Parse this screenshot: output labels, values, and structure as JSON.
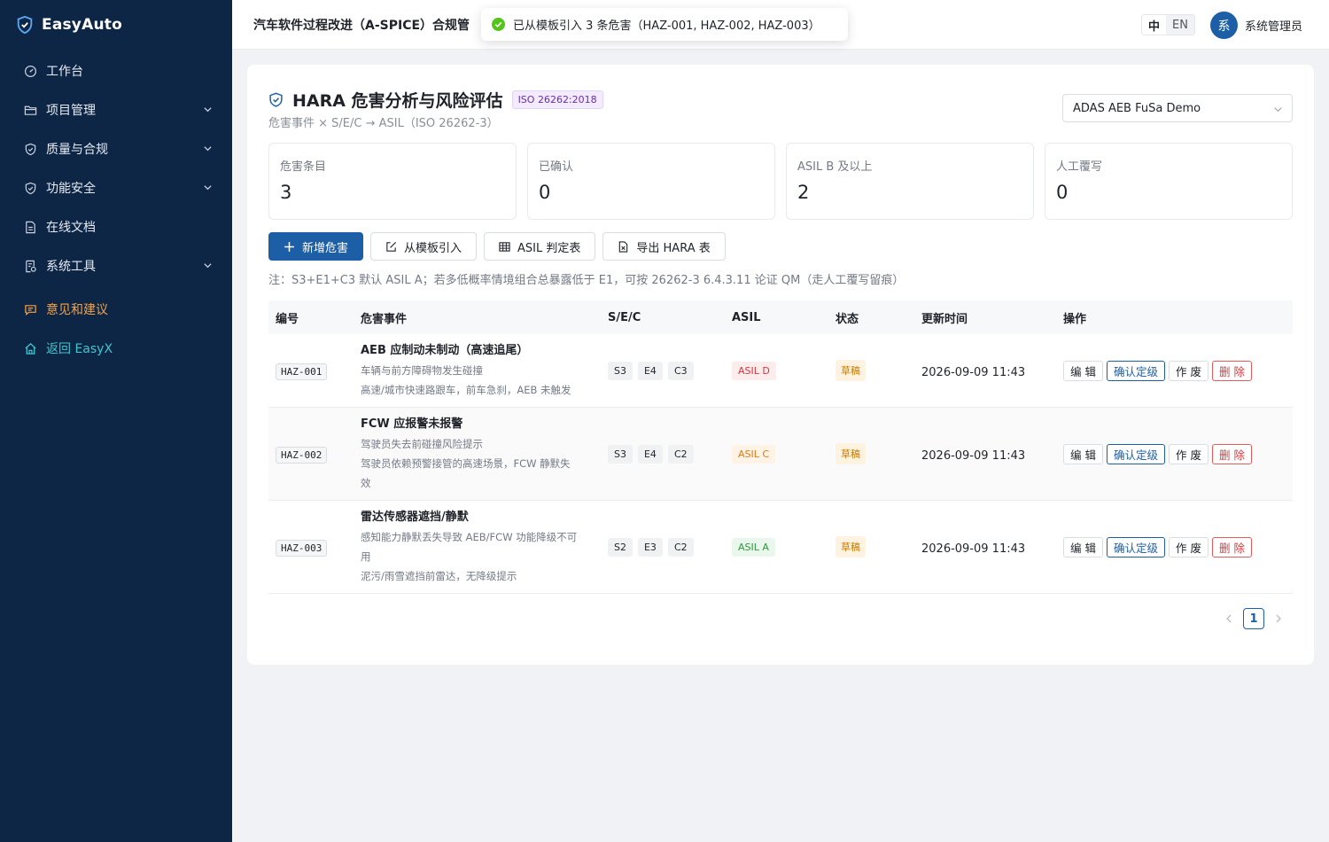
{
  "brand": {
    "name": "EasyAuto"
  },
  "sidebar": {
    "items": [
      {
        "label": "工作台",
        "icon": "dashboard-icon",
        "expandable": false
      },
      {
        "label": "项目管理",
        "icon": "folder-icon",
        "expandable": true
      },
      {
        "label": "质量与合规",
        "icon": "shield-icon",
        "expandable": true
      },
      {
        "label": "功能安全",
        "icon": "shield-check-icon",
        "expandable": true
      },
      {
        "label": "在线文档",
        "icon": "document-icon",
        "expandable": false
      },
      {
        "label": "系统工具",
        "icon": "tools-icon",
        "expandable": true
      }
    ],
    "feedback_label": "意见和建议",
    "back_label": "返回 EasyX"
  },
  "header": {
    "app_title": "汽车软件过程改进（A-SPICE）合规管",
    "lang_zh": "中",
    "lang_en": "EN",
    "avatar_initial": "系",
    "username": "系统管理员"
  },
  "toast": {
    "text": "已从模板引入 3 条危害（HAZ-001, HAZ-002, HAZ-003）"
  },
  "page": {
    "title": "HARA 危害分析与风险评估",
    "standard_tag": "ISO 26262:2018",
    "subtitle": "危害事件 × S/E/C → ASIL（ISO 26262-3）",
    "project_selected": "ADAS AEB FuSa Demo"
  },
  "stats": [
    {
      "label": "危害条目",
      "value": "3"
    },
    {
      "label": "已确认",
      "value": "0"
    },
    {
      "label": "ASIL B 及以上",
      "value": "2"
    },
    {
      "label": "人工覆写",
      "value": "0"
    }
  ],
  "toolbar": {
    "add_label": "新增危害",
    "import_label": "从模板引入",
    "asil_table_label": "ASIL 判定表",
    "export_label": "导出 HARA 表"
  },
  "note": "注：S3+E1+C3 默认 ASIL A；若多低概率情境组合总暴露低于 E1，可按 26262-3 6.4.3.11 论证 QM（走人工覆写留痕）",
  "table": {
    "headers": {
      "id": "编号",
      "event": "危害事件",
      "sec": "S/E/C",
      "asil": "ASIL",
      "status": "状态",
      "time": "更新时间",
      "ops": "操作"
    },
    "ops_labels": {
      "edit": "编 辑",
      "confirm": "确认定级",
      "void": "作 废",
      "delete": "删 除"
    },
    "rows": [
      {
        "id": "HAZ-001",
        "title": "AEB 应制动未制动（高速追尾）",
        "lines": [
          "车辆与前方障碍物发生碰撞",
          "高速/城市快速路跟车，前车急刹，AEB 未触发"
        ],
        "s": "S3",
        "e": "E4",
        "c": "C3",
        "asil": "ASIL D",
        "asil_level": "d",
        "status": "草稿",
        "time": "2026-09-09 11:43"
      },
      {
        "id": "HAZ-002",
        "title": "FCW 应报警未报警",
        "lines": [
          "驾驶员失去前碰撞风险提示",
          "驾驶员依赖预警接管的高速场景，FCW 静默失",
          "效"
        ],
        "s": "S3",
        "e": "E4",
        "c": "C2",
        "asil": "ASIL C",
        "asil_level": "c",
        "status": "草稿",
        "time": "2026-09-09 11:43"
      },
      {
        "id": "HAZ-003",
        "title": "雷达传感器遮挡/静默",
        "lines": [
          "感知能力静默丢失导致 AEB/FCW 功能降级不可",
          "用",
          "泥污/雨雪遮挡前雷达，无降级提示"
        ],
        "s": "S2",
        "e": "E3",
        "c": "C2",
        "asil": "ASIL A",
        "asil_level": "a",
        "status": "草稿",
        "time": "2026-09-09 11:43"
      }
    ]
  },
  "pagination": {
    "current": "1"
  },
  "colors": {
    "sidebar_bg": "#0e2646",
    "primary": "#1d5fa6",
    "feedback": "#f0a24b",
    "back_link": "#3ec7cf",
    "success": "#52c41a"
  }
}
